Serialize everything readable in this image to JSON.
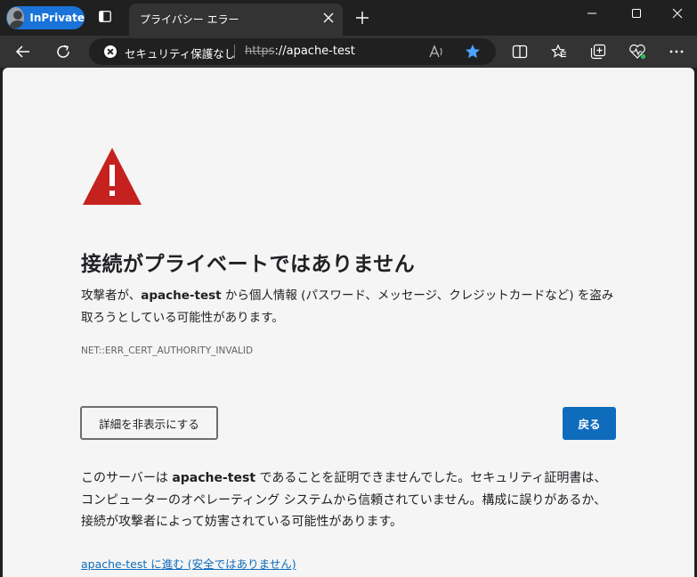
{
  "titlebar": {
    "inprivate_label": "InPrivate",
    "active_tab": {
      "title": "プライバシー エラー"
    }
  },
  "addressbar": {
    "security_label": "セキュリティ保護なし",
    "url_scheme": "https",
    "url_rest": "://apache-test"
  },
  "toolbar_icons": [
    "read-aloud-icon",
    "favorite-star-icon",
    "split-screen-icon",
    "favorites-icon",
    "collections-icon",
    "browser-essentials-icon",
    "more-icon"
  ],
  "colors": {
    "accent": "#0f6cbd",
    "warning": "#c5221f",
    "inprivate": "#1a73d8"
  },
  "page": {
    "heading": "接続がプライベートではありません",
    "desc_pre": "攻撃者が、",
    "desc_host": "apache-test",
    "desc_post": " から個人情報 (パスワード、メッセージ、クレジットカードなど) を盗み取ろうとしている可能性があります。",
    "error_code": "NET::ERR_CERT_AUTHORITY_INVALID",
    "details_button": "詳細を非表示にする",
    "back_button": "戻る",
    "details_pre": "このサーバーは ",
    "details_host": "apache-test",
    "details_post": " であることを証明できませんでした。セキュリティ証明書は、コンピューターのオペレーティング システムから信頼されていません。構成に誤りがあるか、接続が攻撃者によって妨害されている可能性があります。",
    "proceed_link": "apache-test に進む (安全ではありません)"
  }
}
